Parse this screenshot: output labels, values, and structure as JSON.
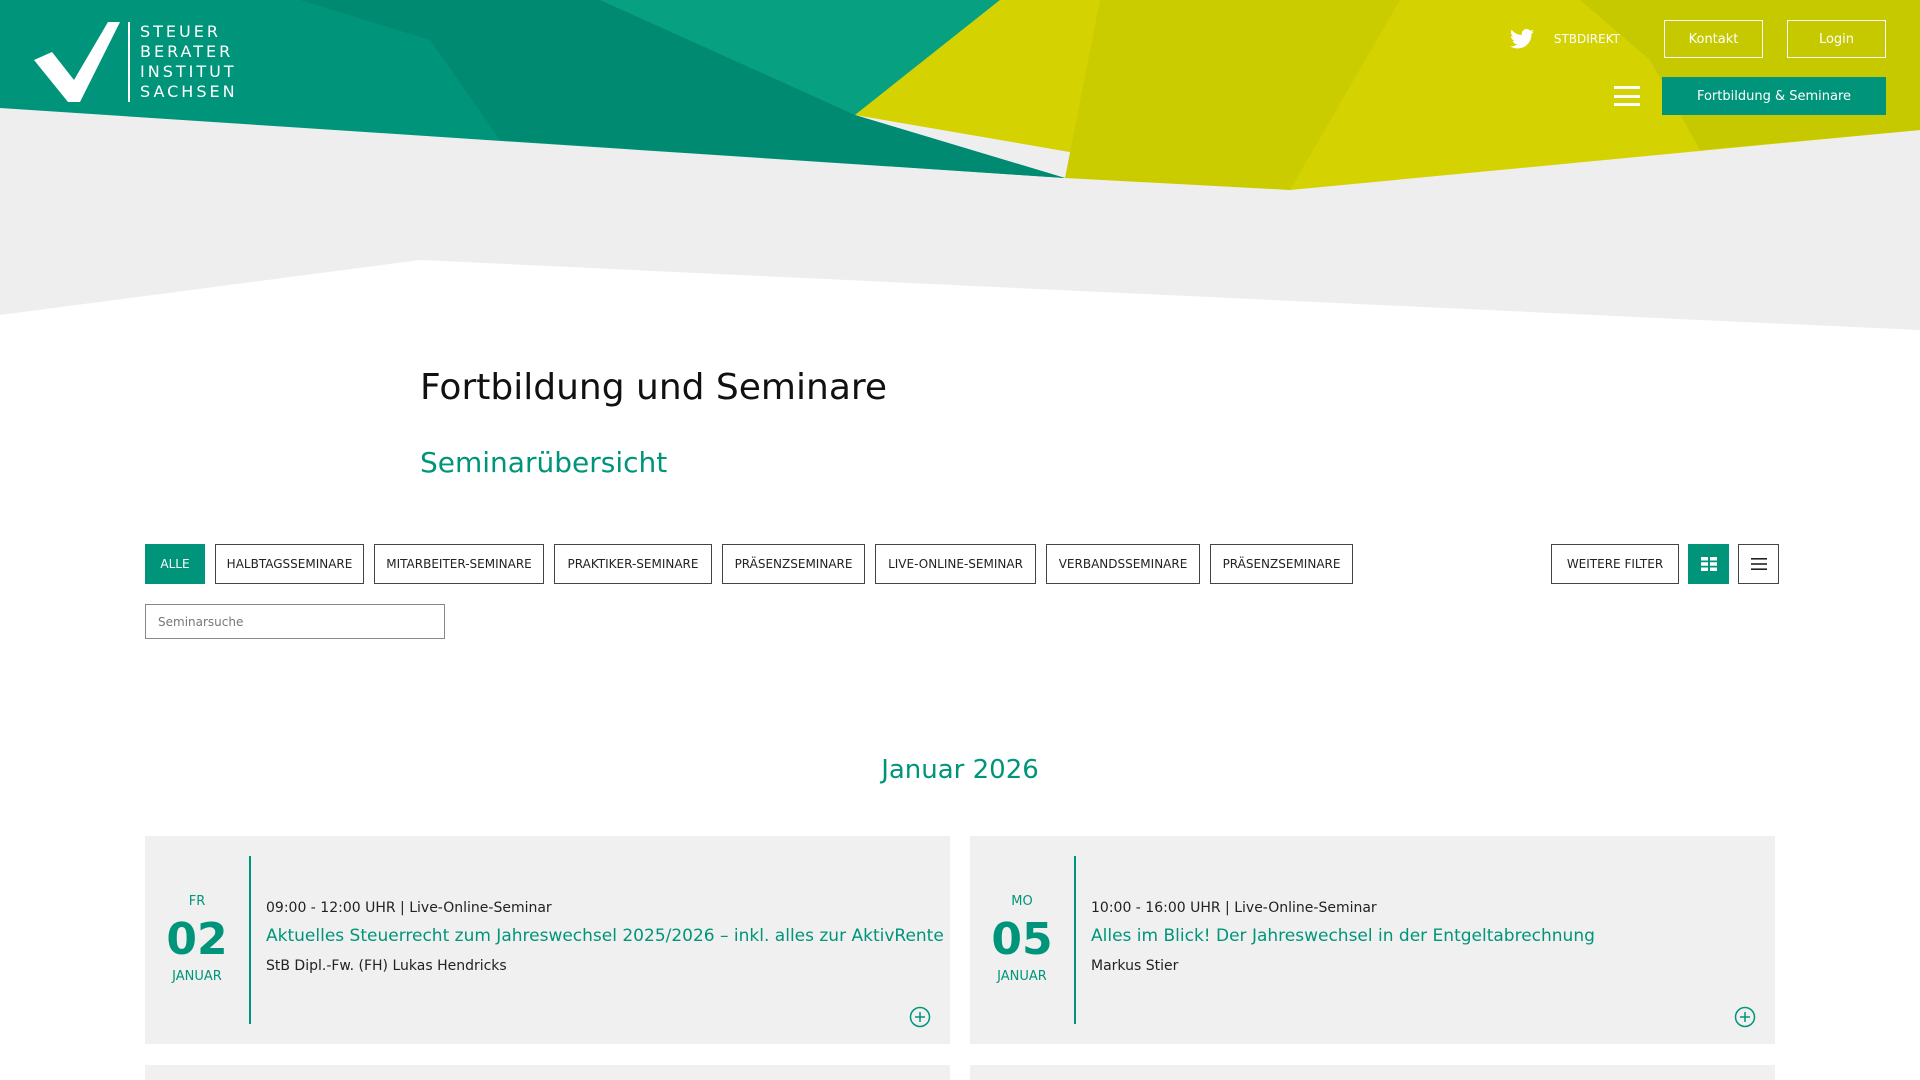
{
  "colors": {
    "green": "#00957a",
    "dark_green": "#008a71",
    "yellow": "#d4d200",
    "light_grey": "#eeeeee"
  },
  "logo": {
    "lines": [
      "STEUER",
      "BERATER",
      "INSTITUT",
      "SACHSEN"
    ]
  },
  "header": {
    "twitter_icon": "twitter-icon",
    "stbdirekt": "STBDIREKT",
    "kontakt": "Kontakt",
    "login": "Login",
    "menu_icon": "hamburger-menu-icon",
    "fortbildung": "Fortbildung & Seminare"
  },
  "page": {
    "title": "Fortbildung und Seminare",
    "subtitle": "Seminarübersicht"
  },
  "filters": [
    {
      "label": "ALLE",
      "active": true
    },
    {
      "label": "HALBTAGSSEMINARE"
    },
    {
      "label": "MITARBEITER-SEMINARE"
    },
    {
      "label": "PRAKTIKER-SEMINARE"
    },
    {
      "label": "PRÄSENZSEMINARE"
    },
    {
      "label": "LIVE-ONLINE-SEMINAR"
    },
    {
      "label": "VERBANDSSEMINARE"
    },
    {
      "label": "PRÄSENZSEMINARE"
    }
  ],
  "tools": {
    "weitere": "WEITERE FILTER",
    "grid_icon": "grid-view-icon",
    "list_icon": "list-view-icon"
  },
  "search": {
    "placeholder": "Seminarsuche"
  },
  "month": "Januar 2026",
  "seminars": [
    {
      "dow": "FR",
      "day": "02",
      "month": "JANUAR",
      "time": "09:00 - 12:00 UHR | Live-Online-Seminar",
      "title": "Aktuelles Steuerrecht zum Jahreswechsel 2025/2026 – inkl. alles zur AktivRente",
      "speaker": "StB Dipl.-Fw. (FH) Lukas Hendricks"
    },
    {
      "dow": "MO",
      "day": "05",
      "month": "JANUAR",
      "time": "10:00 - 16:00 UHR | Live-Online-Seminar",
      "title": "Alles im Blick! Der Jahreswechsel in der Entgeltabrechnung",
      "speaker": "Markus Stier"
    }
  ]
}
